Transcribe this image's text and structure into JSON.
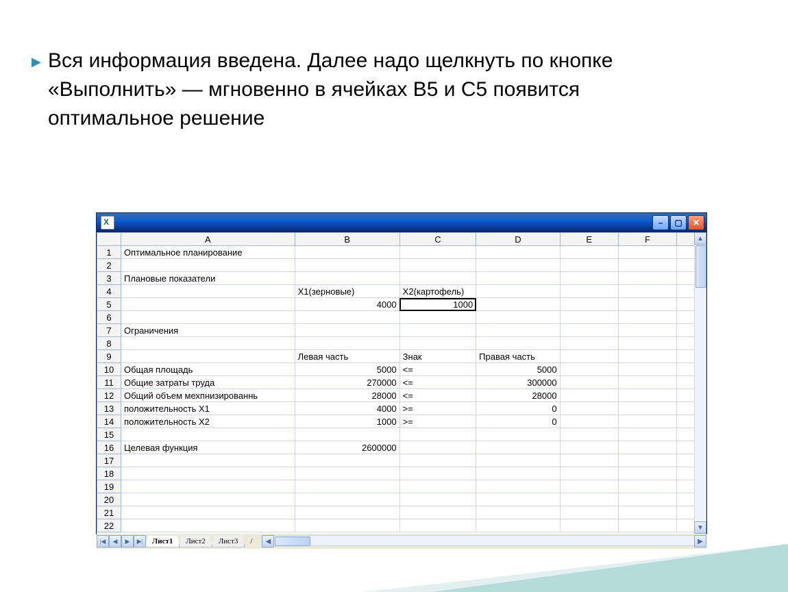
{
  "bullet_text": "Вся информация введена. Далее надо щелкнуть по кнопке «Выполнить» — мгновенно в ячейках B5 и С5 появится оптимальное решение",
  "columns": [
    "A",
    "B",
    "C",
    "D",
    "E",
    "F"
  ],
  "row_headers": [
    "1",
    "2",
    "3",
    "4",
    "5",
    "6",
    "7",
    "8",
    "9",
    "10",
    "11",
    "12",
    "13",
    "14",
    "15",
    "16",
    "17",
    "18",
    "19",
    "20",
    "21",
    "22"
  ],
  "active_column_index": 2,
  "active_row_index": 4,
  "tabs": {
    "items": [
      "Лист1",
      "Лист2",
      "Лист3"
    ],
    "active": 0
  },
  "cells": {
    "r0": {
      "A": "Оптимальное планирование"
    },
    "r2": {
      "A": "Плановые показатели"
    },
    "r3": {
      "B": "X1(зерновые)",
      "C": "X2(картофель)"
    },
    "r4": {
      "B": "4000",
      "C": "1000"
    },
    "r6": {
      "A": "Ограничения"
    },
    "r8": {
      "B": "Левая часть",
      "C": "Знак",
      "D": "Правая часть"
    },
    "r9": {
      "A": "Общая площадь",
      "B": "5000",
      "C": "<=",
      "D": "5000"
    },
    "r10": {
      "A": "Общие затраты труда",
      "B": "270000",
      "C": "<=",
      "D": "300000"
    },
    "r11": {
      "A": "Общий объем мехпнизированнь",
      "B": "28000",
      "C": "<=",
      "D": "28000"
    },
    "r12": {
      "A": "положительность X1",
      "B": "4000",
      "C": ">=",
      "D": "0"
    },
    "r13": {
      "A": "положительность X2",
      "B": "1000",
      "C": ">=",
      "D": "0"
    },
    "r15": {
      "A": "Целевая функция",
      "B": "2600000"
    }
  },
  "numeric_cells": [
    "r4.B",
    "r4.C",
    "r9.B",
    "r9.D",
    "r10.B",
    "r10.D",
    "r11.B",
    "r11.D",
    "r12.B",
    "r12.D",
    "r13.B",
    "r13.D",
    "r15.B"
  ]
}
